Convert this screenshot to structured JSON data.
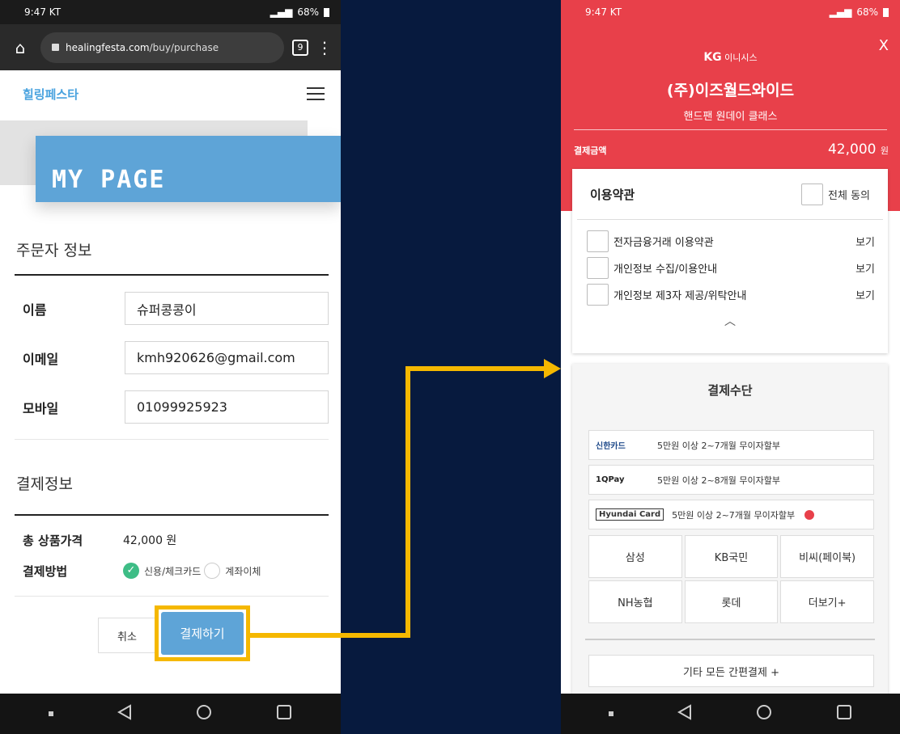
{
  "left_phone": {
    "status": {
      "time": "9:47 KT",
      "battery": "68%"
    },
    "browser": {
      "url_domain": "healingfesta.com",
      "url_path": "/buy/purchase",
      "tab_count": "9"
    },
    "site": {
      "logo": "힐링페스타",
      "banner_title": "MY PAGE"
    },
    "orderer": {
      "title": "주문자 정보",
      "name_label": "이름",
      "name_value": "슈퍼콩콩이",
      "email_label": "이메일",
      "email_value": "kmh920626@gmail.com",
      "mobile_label": "모바일",
      "mobile_value": "01099925923"
    },
    "payment_info": {
      "title": "결제정보",
      "total_label": "총 상품가격",
      "total_value": "42,000 원",
      "method_label": "결제방법",
      "method_card": "신용/체크카드",
      "method_transfer": "계좌이체",
      "selected_method": "신용/체크카드"
    },
    "buttons": {
      "cancel": "취소",
      "pay": "결제하기"
    }
  },
  "right_phone": {
    "status": {
      "time": "9:47 KT",
      "battery": "68%"
    },
    "pg": {
      "close": "X",
      "brand_bold": "KG",
      "brand_rest": "이니시스",
      "merchant": "(주)이즈월드와이드",
      "product": "핸드팬 원데이 클래스",
      "amount_label": "결제금액",
      "amount": "42,000",
      "amount_unit": "원"
    },
    "terms": {
      "title": "이용약관",
      "agree_all": "전체 동의",
      "items": [
        {
          "label": "전자금융거래 이용약관",
          "view": "보기"
        },
        {
          "label": "개인정보 수집/이용안내",
          "view": "보기"
        },
        {
          "label": "개인정보 제3자 제공/위탁안내",
          "view": "보기"
        }
      ]
    },
    "methods": {
      "title": "결제수단",
      "promos": [
        {
          "brand": "신한카드",
          "text": "5만원 이상 2~7개월 무이자할부"
        },
        {
          "brand": "1QPay",
          "text": "5만원 이상 2~8개월 무이자할부"
        },
        {
          "brand": "Hyundai Card",
          "text": "5만원 이상 2~7개월 무이자할부"
        }
      ],
      "cards": [
        "삼성",
        "KB국민",
        "비씨(페이북)",
        "NH농협",
        "롯데",
        "더보기+"
      ],
      "easy_pay": "기타 모든 간편결제 +"
    }
  },
  "colors": {
    "accent_blue": "#5ea4d7",
    "highlight": "#f5b800",
    "pg_red": "#e8404a",
    "bg_navy": "#071a3e"
  }
}
